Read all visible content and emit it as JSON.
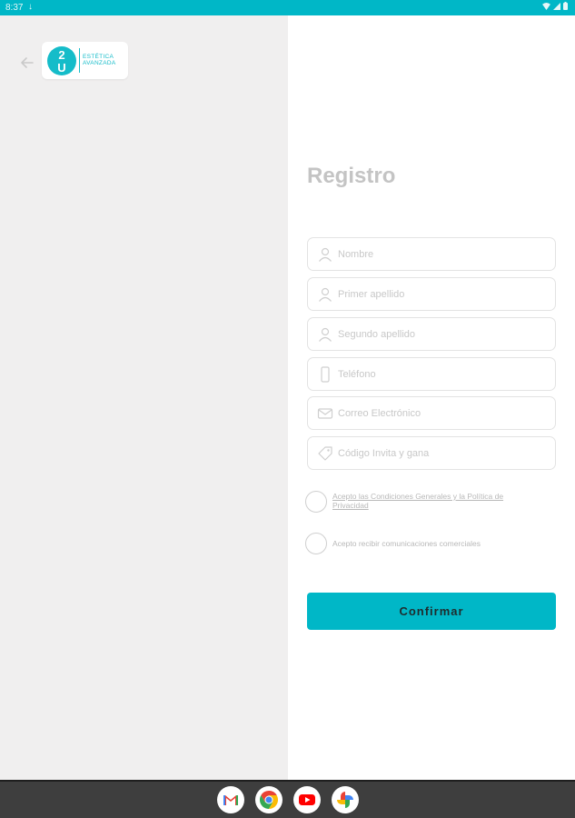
{
  "status_bar": {
    "time": "8:37",
    "left_icon": "download-icon",
    "right_icons": [
      "wifi-icon",
      "signal-icon",
      "battery-icon"
    ]
  },
  "header": {
    "back_icon": "arrow-left-icon",
    "logo": {
      "mark": "2\nU",
      "line1": "ESTÉTICA",
      "line2": "AVANZADA"
    }
  },
  "form": {
    "title": "Registro",
    "fields": [
      {
        "placeholder": "Nombre",
        "icon": "user-icon"
      },
      {
        "placeholder": "Primer apellido",
        "icon": "user-icon"
      },
      {
        "placeholder": "Segundo apellido",
        "icon": "user-icon"
      },
      {
        "placeholder": "Teléfono",
        "icon": "phone-icon"
      },
      {
        "placeholder": "Correo Electrónico",
        "icon": "mail-icon"
      },
      {
        "placeholder": "Código Invita y gana",
        "icon": "tag-icon"
      }
    ],
    "terms_label": "Acepto las Condiciones Generales y la Política de Privacidad",
    "marketing_label": "Acepto recibir comunicaciones comerciales",
    "confirm_label": "Confirmar"
  },
  "dock": {
    "apps": [
      "gmail-icon",
      "chrome-icon",
      "youtube-icon",
      "photos-icon"
    ]
  },
  "colors": {
    "accent": "#00b7c7",
    "left_panel": "#f0efef",
    "dock": "#3e3e3e"
  }
}
